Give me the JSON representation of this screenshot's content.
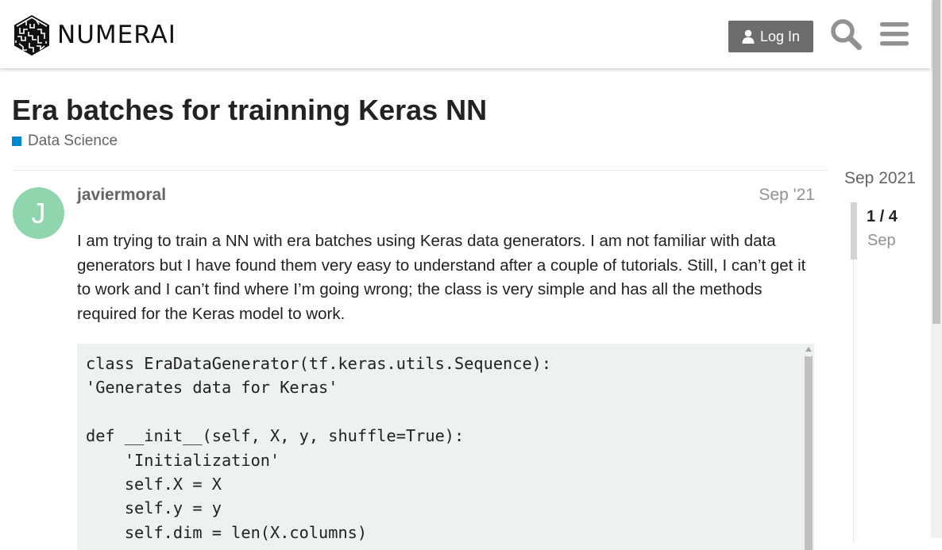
{
  "site": {
    "brand": "NUMERAI",
    "logo_icon": "numerai-cube-logo-icon"
  },
  "header": {
    "login_label": "Log In",
    "user_icon": "user-icon",
    "search_icon": "search-icon",
    "menu_icon": "hamburger-menu-icon"
  },
  "topic": {
    "title": "Era batches for trainning Keras NN",
    "category": "Data Science",
    "category_color": "#0088cc"
  },
  "post": {
    "avatar_letter": "J",
    "avatar_color": "#8fd6ae",
    "username": "javiermoral",
    "date": "Sep '21",
    "body": "I am trying to train a NN with era batches using Keras data generators. I am not familiar with data generators but I have found them very easy to understand after a couple of tutorials. Still, I can’t get it to work and I can’t find where I’m going wrong; the class is very simple and has all the methods required for the Keras model to work.",
    "code": "class EraDataGenerator(tf.keras.utils.Sequence):\n'Generates data for Keras'\n\ndef __init__(self, X, y, shuffle=True):\n    'Initialization'\n    self.X = X\n    self.y = y\n    self.dim = len(X.columns)"
  },
  "timeline": {
    "start_label": "Sep 2021",
    "counter": "1 / 4",
    "current_date": "Sep"
  }
}
